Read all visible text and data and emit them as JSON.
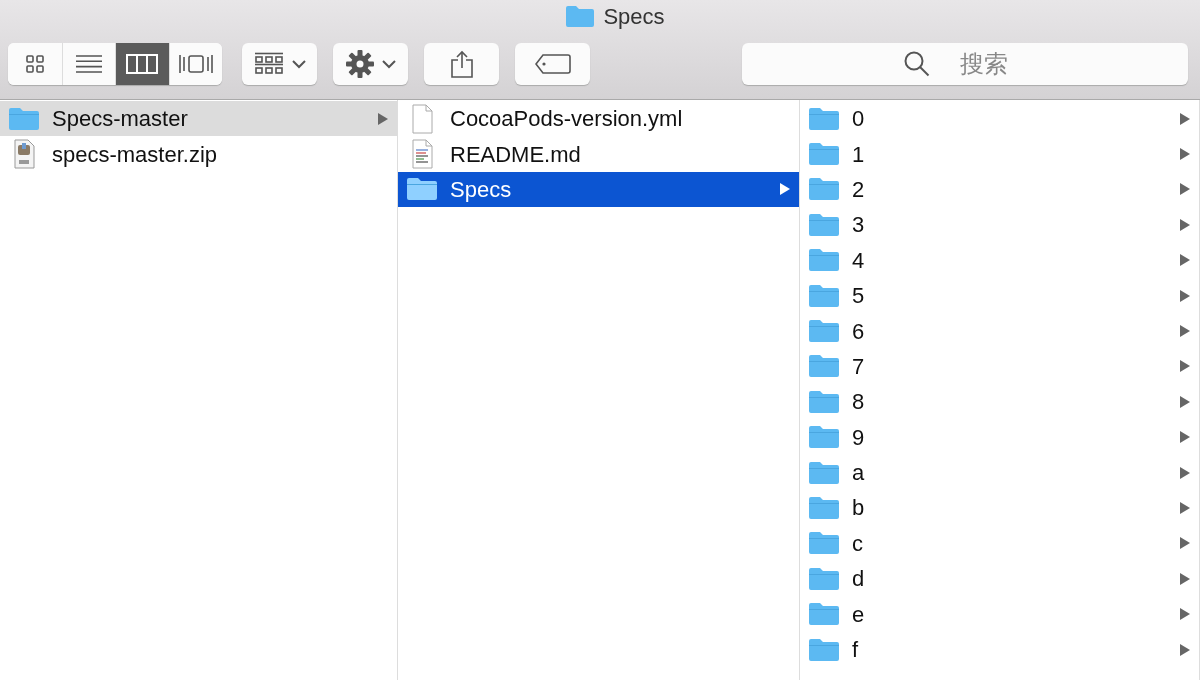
{
  "window": {
    "title": "Specs"
  },
  "view_modes": [
    {
      "kind": "icon",
      "selected": false
    },
    {
      "kind": "list",
      "selected": false
    },
    {
      "kind": "column",
      "selected": true
    },
    {
      "kind": "coverflow",
      "selected": false
    }
  ],
  "toolbar_buttons": [
    {
      "kind": "arrange",
      "dropdown": true
    },
    {
      "kind": "action",
      "dropdown": true
    },
    {
      "kind": "share",
      "dropdown": false
    },
    {
      "kind": "tags",
      "dropdown": false
    }
  ],
  "search": {
    "placeholder": "搜索"
  },
  "columns": [
    {
      "focused": false,
      "items": [
        {
          "name": "Specs-master",
          "kind": "folder",
          "selected": true
        },
        {
          "name": "specs-master.zip",
          "kind": "zip",
          "selected": false
        }
      ]
    },
    {
      "focused": true,
      "items": [
        {
          "name": "CocoaPods-version.yml",
          "kind": "file",
          "selected": false
        },
        {
          "name": "README.md",
          "kind": "doc",
          "selected": false
        },
        {
          "name": "Specs",
          "kind": "folder",
          "selected": true
        }
      ]
    },
    {
      "items": [
        {
          "name": "0",
          "kind": "folder",
          "selected": false
        },
        {
          "name": "1",
          "kind": "folder",
          "selected": false
        },
        {
          "name": "2",
          "kind": "folder",
          "selected": false
        },
        {
          "name": "3",
          "kind": "folder",
          "selected": false
        },
        {
          "name": "4",
          "kind": "folder",
          "selected": false
        },
        {
          "name": "5",
          "kind": "folder",
          "selected": false
        },
        {
          "name": "6",
          "kind": "folder",
          "selected": false
        },
        {
          "name": "7",
          "kind": "folder",
          "selected": false
        },
        {
          "name": "8",
          "kind": "folder",
          "selected": false
        },
        {
          "name": "9",
          "kind": "folder",
          "selected": false
        },
        {
          "name": "a",
          "kind": "folder",
          "selected": false
        },
        {
          "name": "b",
          "kind": "folder",
          "selected": false
        },
        {
          "name": "c",
          "kind": "folder",
          "selected": false
        },
        {
          "name": "d",
          "kind": "folder",
          "selected": false
        },
        {
          "name": "e",
          "kind": "folder",
          "selected": false
        },
        {
          "name": "f",
          "kind": "folder",
          "selected": false
        }
      ]
    }
  ]
}
